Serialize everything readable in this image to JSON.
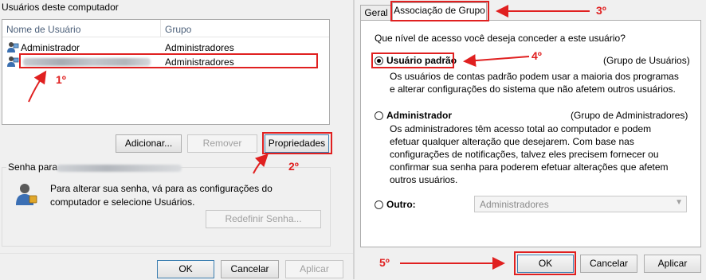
{
  "left": {
    "title": "Usuários deste computador",
    "columns": [
      "Nome de Usuário",
      "Grupo"
    ],
    "rows": [
      {
        "name": "Administrador",
        "group": "Administradores"
      },
      {
        "name": "",
        "group": "Administradores"
      }
    ],
    "buttons": {
      "add": "Adicionar...",
      "remove": "Remover",
      "properties": "Propriedades"
    },
    "password_group_label": "Senha para",
    "password_text": "Para alterar sua senha, vá para as configurações do computador e selecione Usuários.",
    "reset_button": "Redefinir Senha...",
    "footer": {
      "ok": "OK",
      "cancel": "Cancelar",
      "apply": "Aplicar"
    }
  },
  "right": {
    "tabs": [
      "Geral",
      "Associação de Grupo"
    ],
    "question": "Que nível de acesso você deseja conceder a este usuário?",
    "options": [
      {
        "label": "Usuário padrão",
        "group": "(Grupo de Usuários)",
        "desc": [
          "Os usuários de contas padrão podem usar a maioria dos programas",
          "e alterar configurações do sistema que não afetem outros usuários."
        ],
        "checked": true
      },
      {
        "label": "Administrador",
        "group": "(Grupo de Administradores)",
        "desc": [
          "Os administradores têm acesso total ao computador e podem",
          "efetuar qualquer alteração que desejarem. Com base nas",
          "configurações de notificações, talvez eles precisem fornecer ou",
          "confirmar sua senha para poderem efetuar alterações que afetem",
          "outros usuários."
        ],
        "checked": false
      },
      {
        "label": "Outro:",
        "checked": false
      }
    ],
    "other_select": "Administradores",
    "footer": {
      "ok": "OK",
      "cancel": "Cancelar",
      "apply": "Aplicar"
    }
  },
  "annotations": [
    "1º",
    "2º",
    "3º",
    "4º",
    "5º"
  ],
  "colors": {
    "annotation": "#e02020",
    "dialog_bg": "#f0f0f0",
    "header_text": "#4c607a"
  }
}
